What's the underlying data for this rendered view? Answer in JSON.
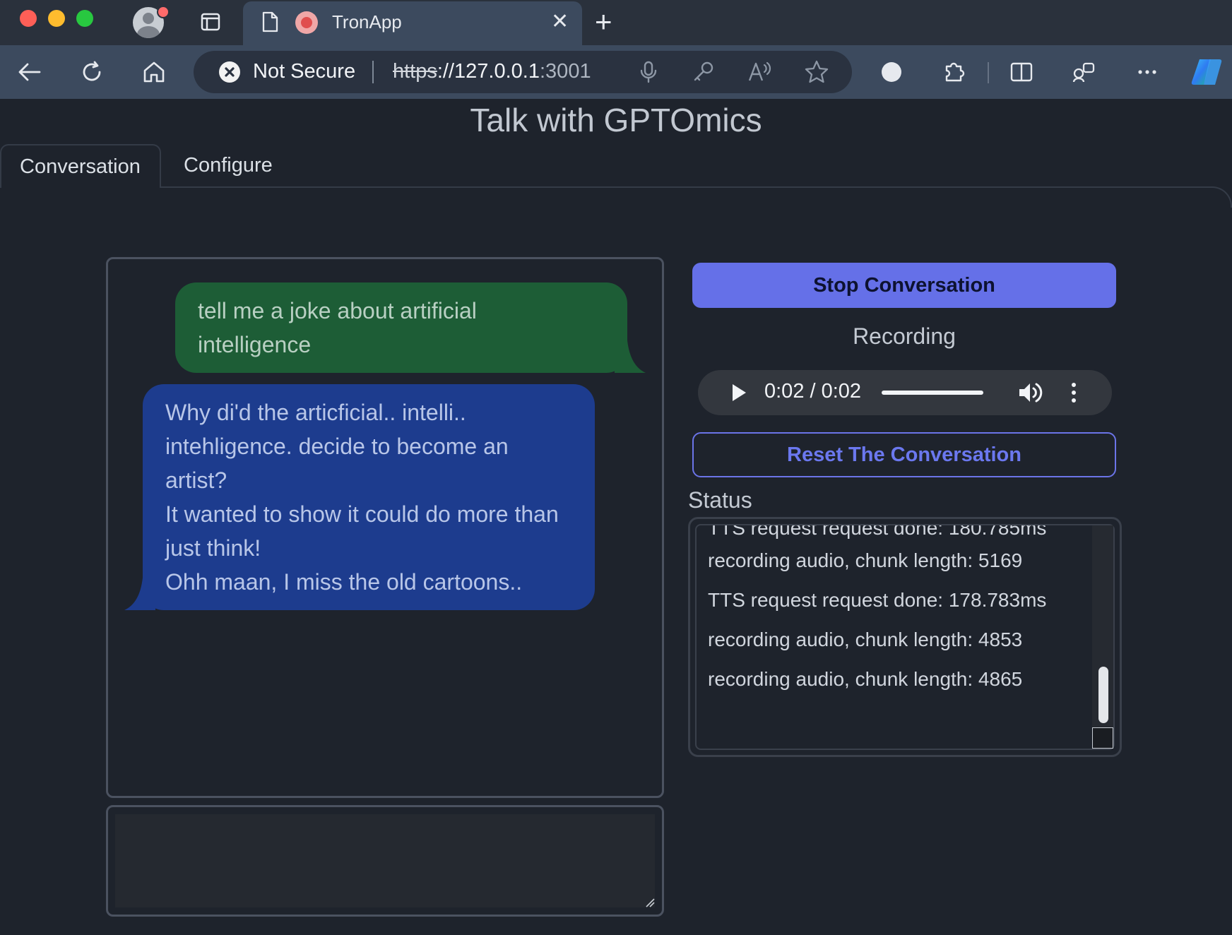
{
  "browser": {
    "tab_title": "TronApp",
    "security_label": "Not Secure",
    "url_scheme": "https",
    "url_host": "://127.0.0.1",
    "url_port": ":3001"
  },
  "page": {
    "title": "Talk with GPTOmics",
    "tabs": [
      {
        "label": "Conversation",
        "active": true
      },
      {
        "label": "Configure",
        "active": false
      }
    ]
  },
  "conversation": {
    "messages": [
      {
        "role": "user",
        "text": "tell me a joke about artificial\nintelligence"
      },
      {
        "role": "assistant",
        "text": "Why di'd the articficial.. intelli..\nintehligence. decide to become an\nartist?\nIt wanted to show it could do more than\njust think!\nOhh maan, I miss the old cartoons.."
      }
    ],
    "input_value": ""
  },
  "controls": {
    "stop_label": "Stop Conversation",
    "recording_label": "Recording",
    "audio_time": "0:02 / 0:02",
    "audio_progress": 1.0,
    "reset_label": "Reset The Conversation"
  },
  "status": {
    "label": "Status",
    "lines": [
      "TTS request request done: 180.785ms",
      "recording audio, chunk length: 5169",
      "TTS request request done: 178.783ms",
      "recording audio, chunk length: 4853",
      "recording audio, chunk length: 4865"
    ]
  },
  "colors": {
    "accent": "#6570e8",
    "user_bubble": "#1d5d36",
    "assistant_bubble": "#1d3c8e",
    "background": "#1e232c"
  }
}
